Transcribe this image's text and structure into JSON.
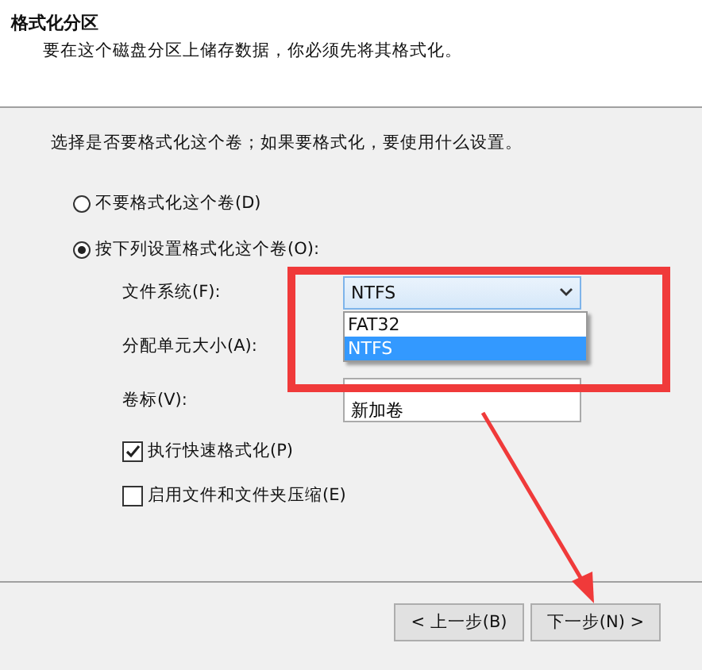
{
  "header": {
    "title": "格式化分区",
    "subtitle": "要在这个磁盘分区上储存数据，你必须先将其格式化。"
  },
  "instruction": "选择是否要格式化这个卷；如果要格式化，要使用什么设置。",
  "options": [
    {
      "label": "不要格式化这个卷(D)",
      "selected": false
    },
    {
      "label": "按下列设置格式化这个卷(O):",
      "selected": true
    }
  ],
  "file_system": {
    "label": "文件系统(F):",
    "value": "NTFS",
    "expanded": true,
    "list": [
      {
        "label": "FAT32",
        "selected": false
      },
      {
        "label": "NTFS",
        "selected": true
      }
    ]
  },
  "allocation_unit": {
    "label": "分配单元大小(A):"
  },
  "volume_label": {
    "label": "卷标(V):",
    "value": "新加卷"
  },
  "checkboxes": [
    {
      "label": "执行快速格式化(P)",
      "checked": true
    },
    {
      "label": "启用文件和文件夹压缩(E)",
      "checked": false
    }
  ],
  "buttons": [
    "< 上一步(B)",
    "下一步(N) >"
  ]
}
